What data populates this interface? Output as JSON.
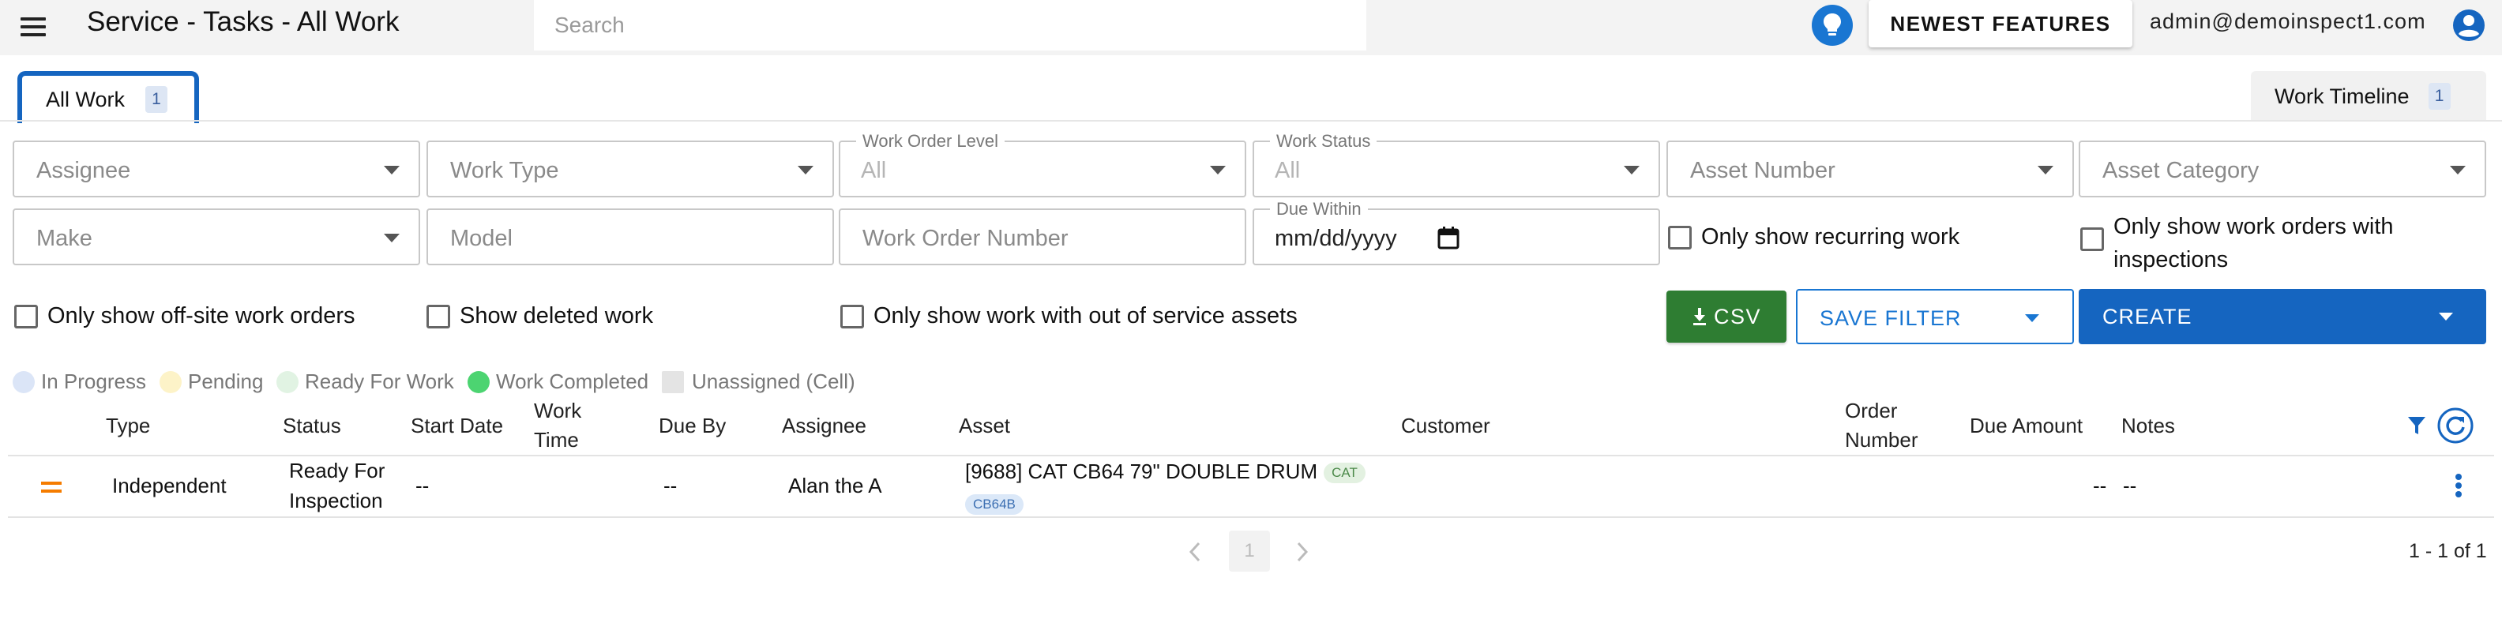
{
  "header": {
    "title": "Service - Tasks - All Work",
    "search_placeholder": "Search",
    "features_button": "NEWEST FEATURES",
    "user_email": "admin@demoinspect1.com",
    "accent_color": "#1976d2"
  },
  "tabs": [
    {
      "label": "All Work",
      "count": "1",
      "active": true
    },
    {
      "label": "Work Timeline",
      "count": "1",
      "active": false
    }
  ],
  "filters": {
    "assignee": {
      "placeholder": "Assignee"
    },
    "work_type": {
      "placeholder": "Work Type"
    },
    "work_order_level": {
      "label": "Work Order Level",
      "value": "All"
    },
    "work_status": {
      "label": "Work Status",
      "value": "All"
    },
    "asset_number": {
      "placeholder": "Asset Number"
    },
    "asset_category": {
      "placeholder": "Asset Category"
    },
    "make": {
      "placeholder": "Make"
    },
    "model": {
      "placeholder": "Model"
    },
    "work_order_number": {
      "placeholder": "Work Order Number"
    },
    "due_within": {
      "label": "Due Within",
      "value": "mm/dd/yyyy"
    },
    "checkboxes": {
      "recurring": "Only show recurring work",
      "inspections": "Only show work orders with inspections",
      "off_site": "Only show off-site work orders",
      "deleted": "Show deleted work",
      "out_of_service": "Only show work with out of service assets"
    }
  },
  "actions": {
    "csv": "CSV",
    "save_filter": "SAVE FILTER",
    "create": "CREATE",
    "csv_color": "#2e7d32",
    "create_color": "#1565c0"
  },
  "legend": [
    {
      "label": "In Progress",
      "color": "#dbe5f7",
      "shape": "circle"
    },
    {
      "label": "Pending",
      "color": "#fdf3c8",
      "shape": "circle"
    },
    {
      "label": "Ready For Work",
      "color": "#e1f3e3",
      "shape": "circle"
    },
    {
      "label": "Work Completed",
      "color": "#4cd471",
      "shape": "circle"
    },
    {
      "label": "Unassigned (Cell)",
      "color": "#e4e4e4",
      "shape": "square"
    }
  ],
  "table": {
    "columns": [
      "Type",
      "Status",
      "Start Date",
      "Work Time",
      "Due By",
      "Assignee",
      "Asset",
      "Customer",
      "Order Number",
      "Due Amount",
      "Notes"
    ],
    "columns_split": {
      "work_time": [
        "Work",
        "Time"
      ],
      "order_number": [
        "Order",
        "Number"
      ]
    },
    "rows": [
      {
        "type": "Independent",
        "status_line1": "Ready For",
        "status_line2": "Inspection",
        "start_date": "--",
        "work_time": "",
        "due_by": "--",
        "assignee": "Alan the A",
        "asset": "[9688] CAT CB64 79\" DOUBLE DRUM",
        "asset_make_chip": "CAT",
        "asset_model_chip": "CB64B",
        "customer": "",
        "order_number": "",
        "due_amount": "--",
        "notes": "--"
      }
    ]
  },
  "pagination": {
    "current_page": "1",
    "range": "1 - 1 of 1"
  }
}
